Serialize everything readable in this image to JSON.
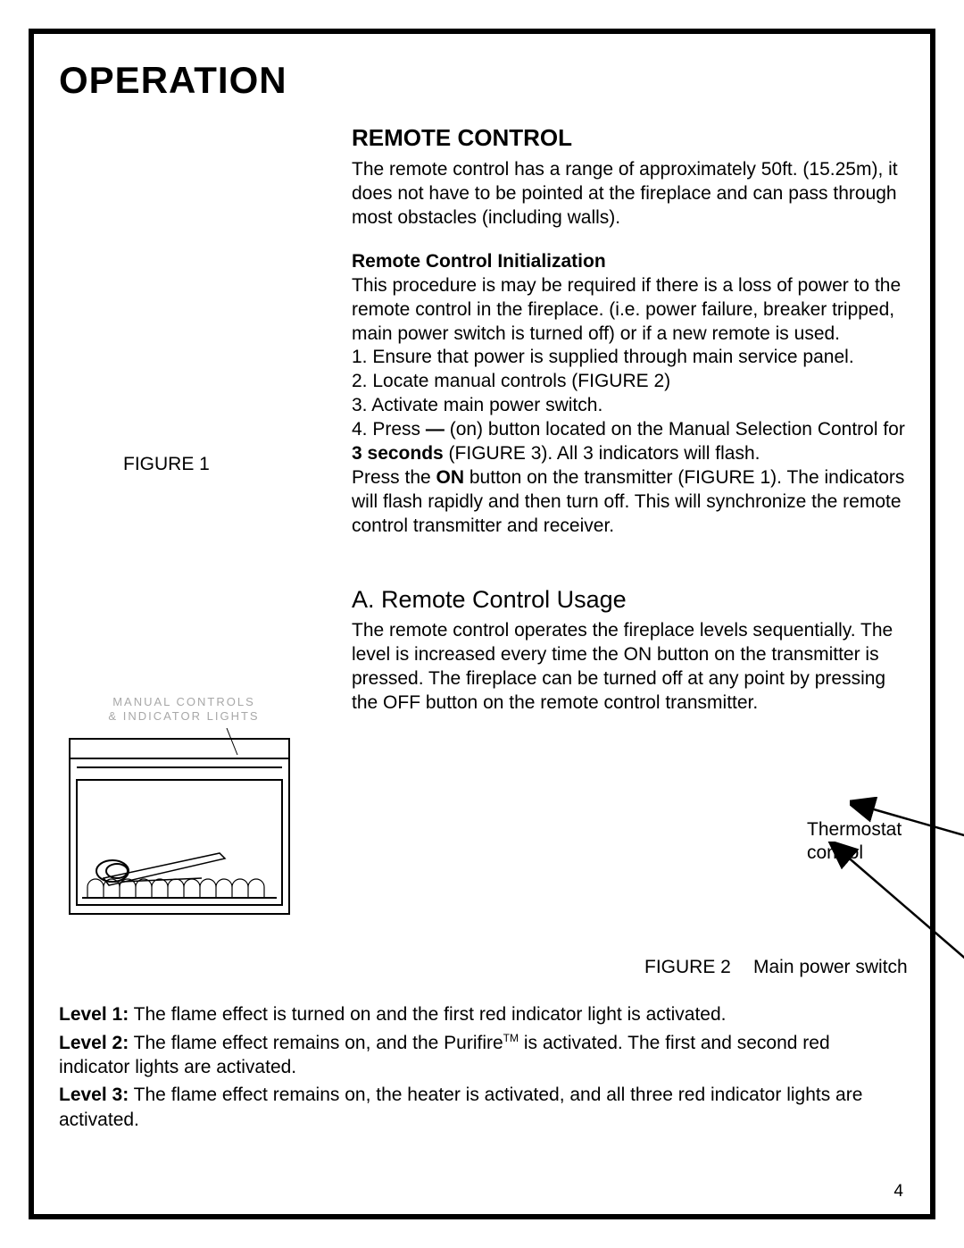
{
  "page_number": "4",
  "section_heading": "OPERATION",
  "remote": {
    "heading": "REMOTE CONTROL",
    "intro": "The remote control has a range of approximately 50ft. (15.25m), it does not have to be pointed at the fireplace and can pass through most obstacles (including walls).",
    "init_heading": "Remote Control Initialization",
    "init_intro": "This procedure is may be required if there is a loss of power to the remote control in the fireplace.  (i.e. power failure, breaker tripped, main power switch is turned off) or if a new remote is used.",
    "steps": {
      "s1": "1. Ensure that power is supplied through main service panel.",
      "s2": "2. Locate manual controls (FIGURE 2)",
      "s3": "3. Activate main power switch.",
      "s4a": "4. Press  ",
      "s4_dash": "—",
      "s4b": "  (on) button located on the Manual Selection Control for ",
      "s4_bold": "3 seconds",
      "s4c": " (FIGURE 3). All 3 indicators will flash.",
      "s5a": "Press the ",
      "s5_bold": "ON",
      "s5b": " button on the transmitter (FIGURE 1). The indicators will flash rapidly and then turn off. This will synchronize the remote control transmitter and receiver."
    }
  },
  "figure1_caption": "FIGURE 1",
  "usage": {
    "heading": "A. Remote Control Usage",
    "body": "The remote control operates the fireplace levels sequentially.  The level is increased every time the ON button on the transmitter is pressed.  The fireplace can be turned off at any point by pressing the OFF button on the remote control transmitter."
  },
  "fireplace_diagram": {
    "line1": "MANUAL CONTROLS",
    "line2": "& INDICATOR LIGHTS"
  },
  "figure2": {
    "caption": "FIGURE 2",
    "thermostat_label": "Thermostat control",
    "main_power_label": "Main power switch"
  },
  "levels": {
    "l1_label": "Level 1:",
    "l1_text": "  The flame effect is turned on and the first red indicator light is activated.",
    "l2_label": "Level 2:",
    "l2a": "  The flame effect remains on, and the Purifire",
    "l2_tm": "TM",
    "l2b": " is activated. The first and second red indicator lights are activated.",
    "l3_label": "Level 3:",
    "l3_text": "  The flame effect remains on, the heater is activated, and all three red indicator lights are activated."
  }
}
